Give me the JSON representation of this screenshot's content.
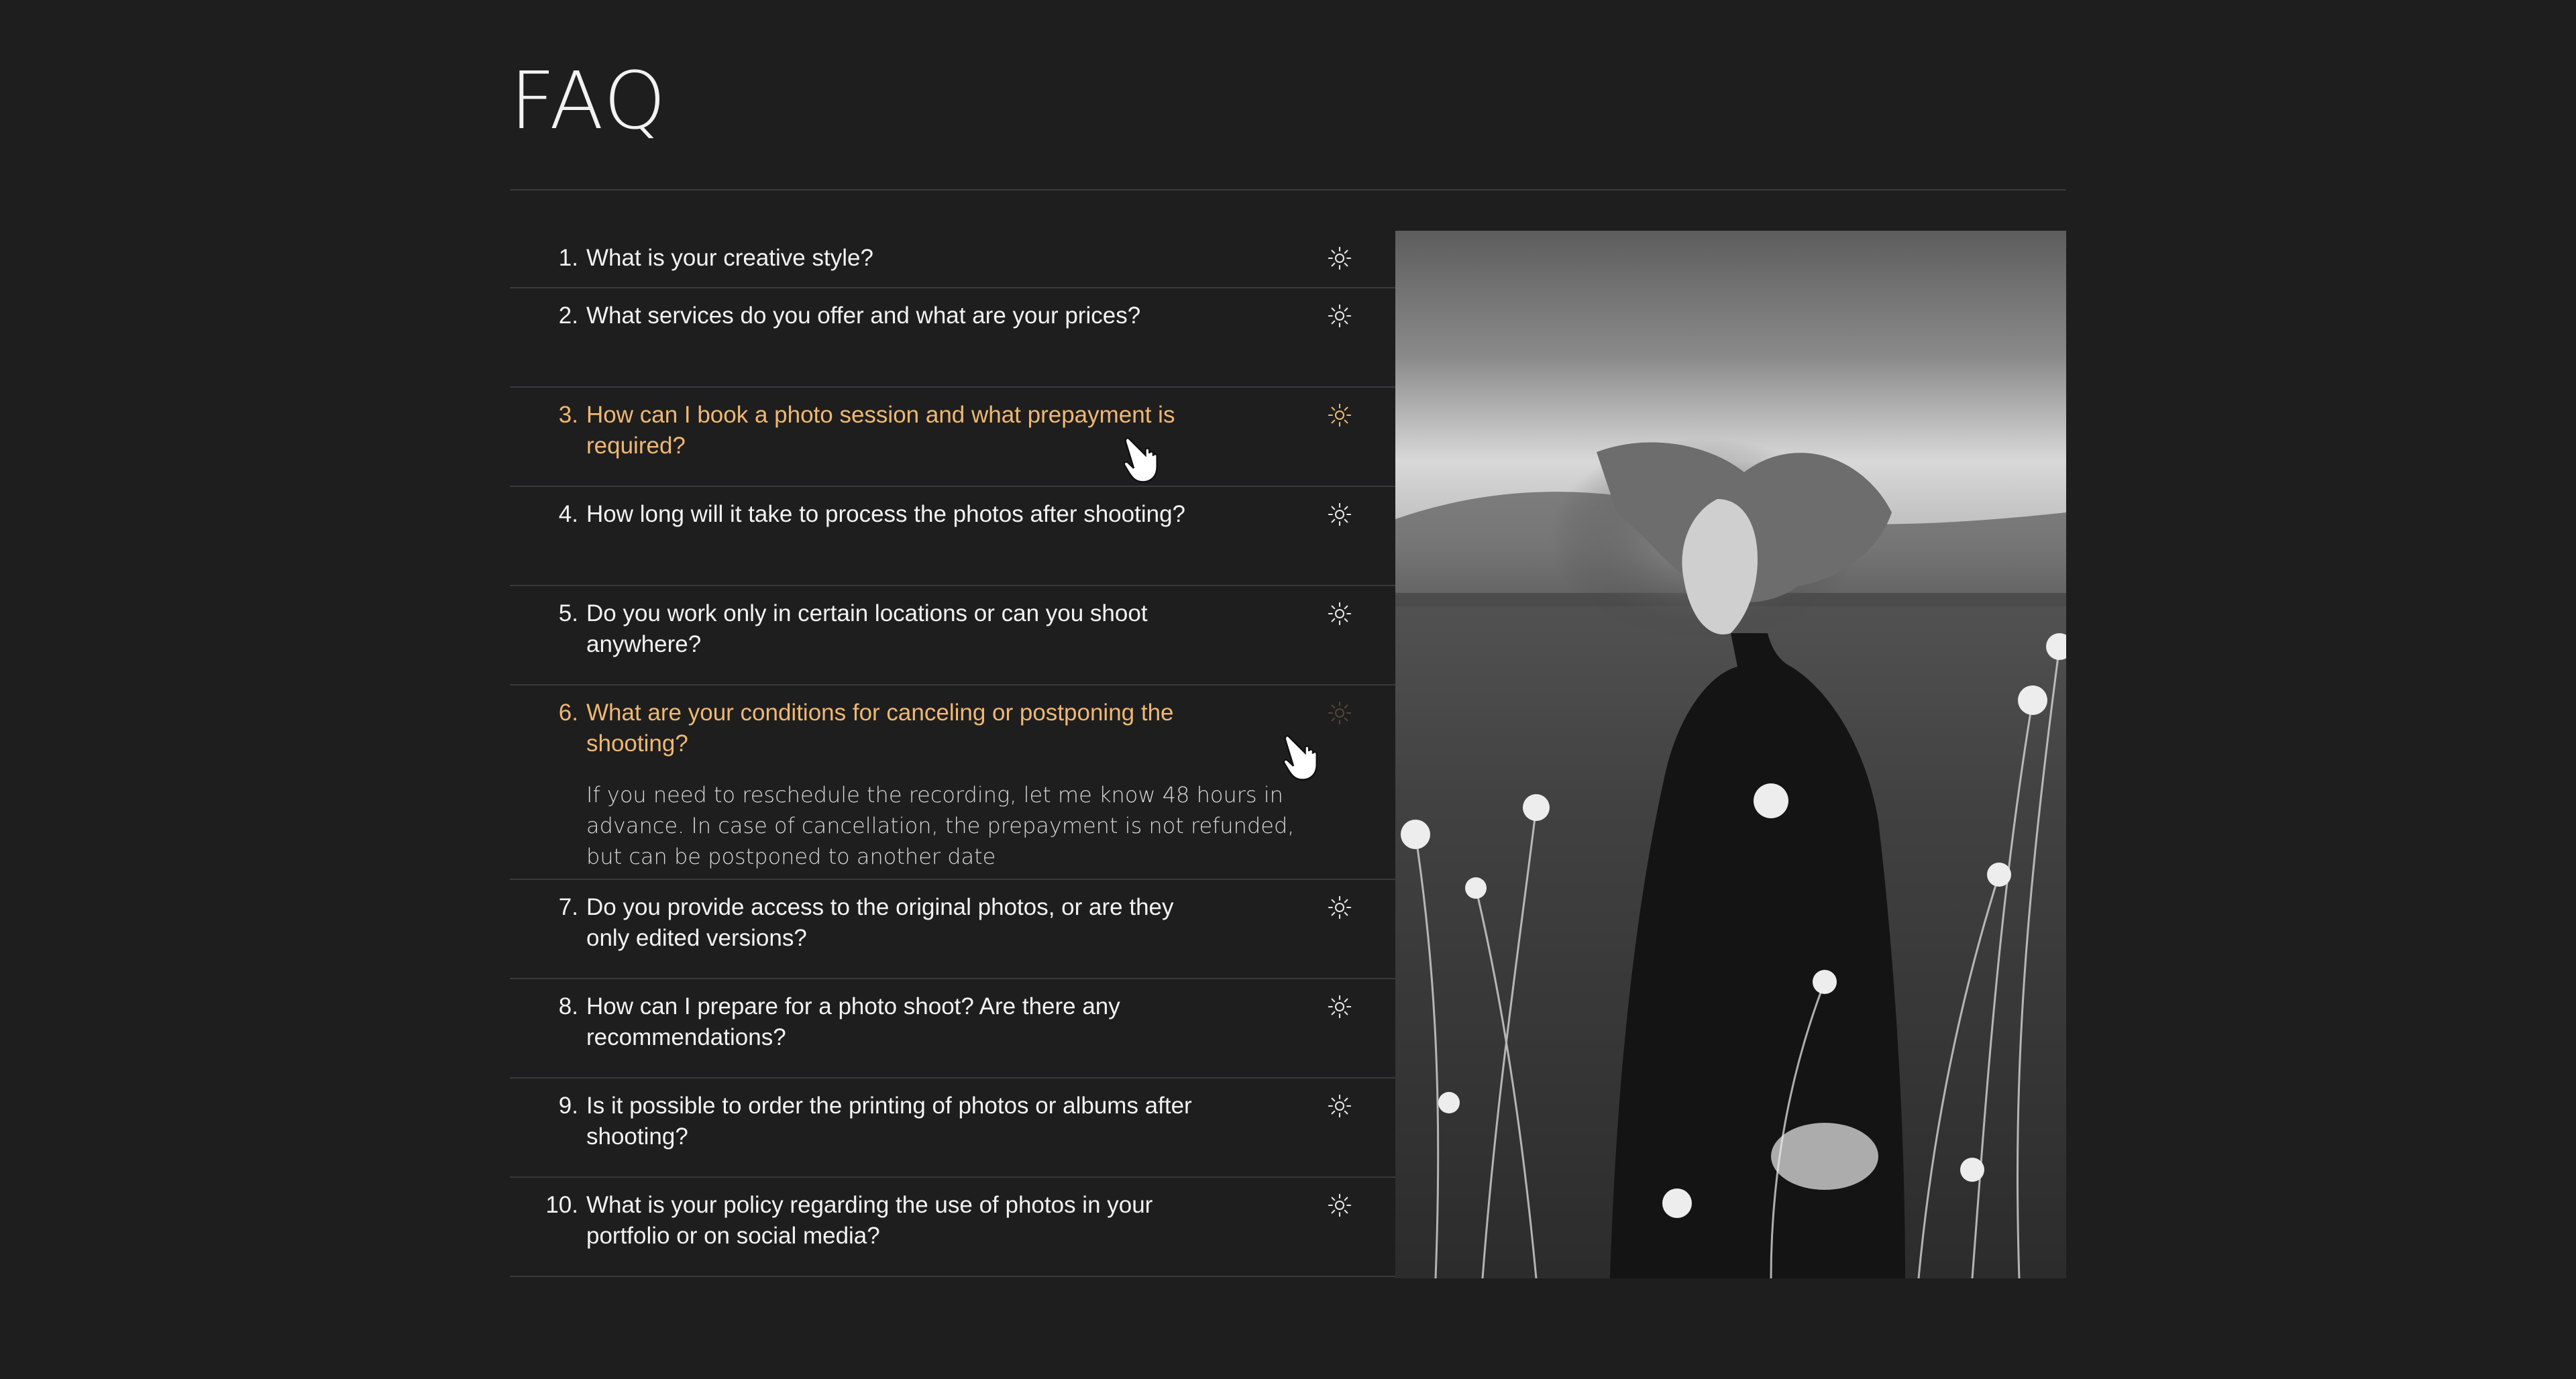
{
  "page": {
    "title": "FAQ"
  },
  "faq": {
    "items": [
      {
        "number": "1.",
        "question": "What is your creative style?"
      },
      {
        "number": "2.",
        "question": "What services do you offer and what are your prices?"
      },
      {
        "number": "3.",
        "question": "How can I book a photo session and what prepayment is required?"
      },
      {
        "number": "4.",
        "question": "How long will it take to process the photos after shooting?"
      },
      {
        "number": "5.",
        "question": "Do you work only in certain locations or can you shoot anywhere?"
      },
      {
        "number": "6.",
        "question": "What are your conditions for canceling or postponing the shooting?",
        "answer": "If you need to reschedule the recording, let me know 48 hours in advance. In case of cancellation, the prepayment is not refunded, but can be postponed to another date"
      },
      {
        "number": "7.",
        "question": "Do you provide access to the original photos, or are they only edited versions?"
      },
      {
        "number": "8.",
        "question": "How can I prepare for a photo shoot? Are there any recommendations?"
      },
      {
        "number": "9.",
        "question": "Is it possible to order the printing of photos or albums after shooting?"
      },
      {
        "number": "10.",
        "question": "What is your policy regarding the use of photos in your portfolio or on social media?"
      }
    ]
  },
  "colors": {
    "background": "#1e1e1f",
    "text": "#f3f3f3",
    "accent": "#f0b870",
    "divider": "#3a3a3c"
  },
  "icons": {
    "toggle": "sun-icon",
    "cursor": "hand-pointer-icon"
  }
}
